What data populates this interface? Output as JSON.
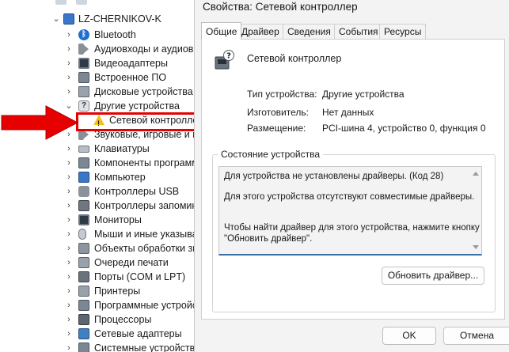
{
  "device_tree": {
    "root": "LZ-CHERNIKOV-K",
    "items": [
      {
        "label": "Bluetooth",
        "icon": "bluetooth-icon"
      },
      {
        "label": "Аудиовходы и аудиов",
        "icon": "speaker-icon"
      },
      {
        "label": "Видеоадаптеры",
        "icon": "display-adapter-icon"
      },
      {
        "label": "Встроенное ПО",
        "icon": "firmware-icon"
      },
      {
        "label": "Дисковые устройства",
        "icon": "disk-icon"
      },
      {
        "label": "Другие устройства",
        "icon": "unknown-device-icon"
      },
      {
        "label": "Сетевой контролле",
        "icon": "warning-icon"
      },
      {
        "label": "Звуковые, игровые и в",
        "icon": "speaker-icon"
      },
      {
        "label": "Клавиатуры",
        "icon": "keyboard-icon"
      },
      {
        "label": "Компоненты программ",
        "icon": "software-component-icon"
      },
      {
        "label": "Компьютер",
        "icon": "computer-icon"
      },
      {
        "label": "Контроллеры USB",
        "icon": "usb-icon"
      },
      {
        "label": "Контроллеры запомин",
        "icon": "storage-controller-icon"
      },
      {
        "label": "Мониторы",
        "icon": "monitor-icon"
      },
      {
        "label": "Мыши и иные указыва",
        "icon": "mouse-icon"
      },
      {
        "label": "Объекты обработки зву",
        "icon": "audio-processing-icon"
      },
      {
        "label": "Очереди печати",
        "icon": "print-queue-icon"
      },
      {
        "label": "Порты (COM и LPT)",
        "icon": "port-icon"
      },
      {
        "label": "Принтеры",
        "icon": "printer-icon"
      },
      {
        "label": "Программные устройс",
        "icon": "software-device-icon"
      },
      {
        "label": "Процессоры",
        "icon": "processor-icon"
      },
      {
        "label": "Сетевые адаптеры",
        "icon": "network-adapter-icon"
      },
      {
        "label": "Системные устройства",
        "icon": "system-device-icon"
      }
    ]
  },
  "dialog": {
    "title": "Свойства: Сетевой контроллер",
    "tabs": [
      {
        "label": "Общие",
        "active": true
      },
      {
        "label": "Драйвер",
        "active": false
      },
      {
        "label": "Сведения",
        "active": false
      },
      {
        "label": "События",
        "active": false
      },
      {
        "label": "Ресурсы",
        "active": false
      }
    ],
    "device_name": "Сетевой контроллер",
    "properties": [
      {
        "label": "Тип устройства:",
        "value": "Другие устройства"
      },
      {
        "label": "Изготовитель:",
        "value": "Нет данных"
      },
      {
        "label": "Размещение:",
        "value": "PCI-шина 4, устройство 0, функция 0"
      }
    ],
    "status_group_label": "Состояние устройства",
    "status_lines": [
      "Для устройства не установлены драйверы. (Код 28)",
      "Для этого устройства отсутствуют совместимые драйверы.",
      "Чтобы найти драйвер для этого устройства, нажмите кнопку",
      "\"Обновить драйвер\"."
    ],
    "update_driver_label": "Обновить драйвер...",
    "ok_label": "OK",
    "cancel_label": "Отмена"
  },
  "colors": {
    "highlight": "#e60000",
    "dialog_bg": "#f3f3f3",
    "accent": "#3a6ea5"
  }
}
